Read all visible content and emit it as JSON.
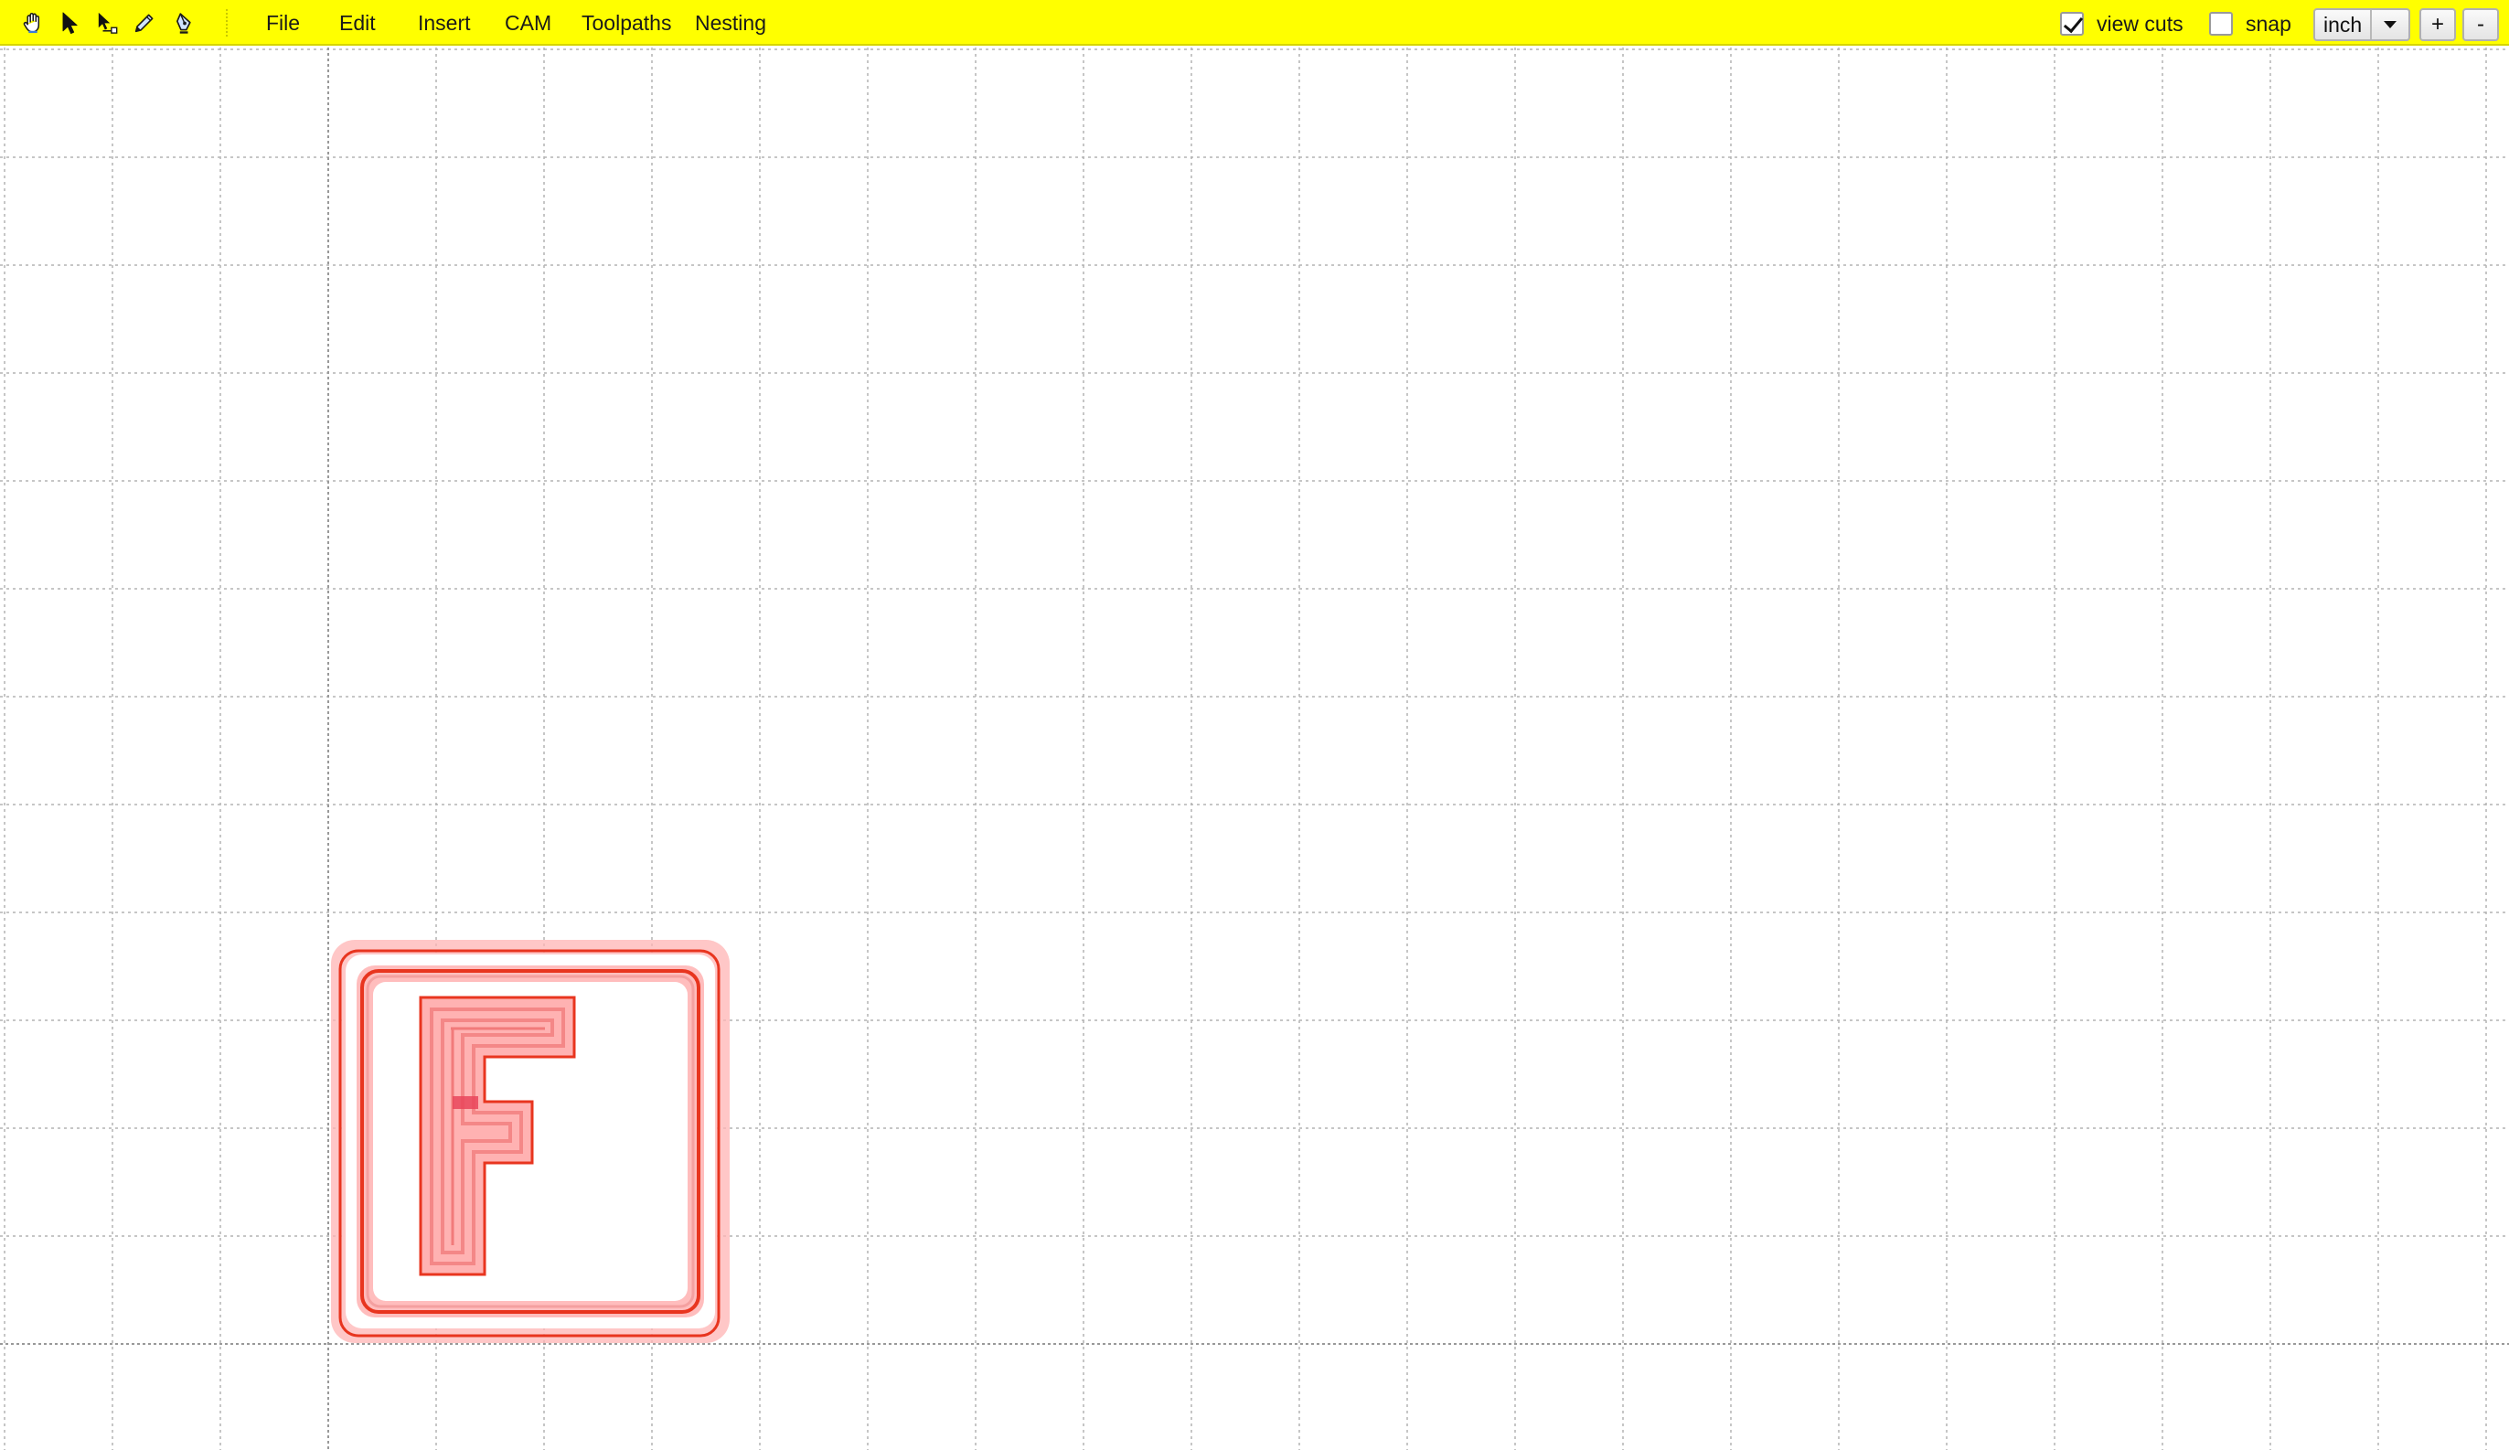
{
  "toolbar": {
    "tools": [
      {
        "name": "pan-hand-icon"
      },
      {
        "name": "select-arrow-icon"
      },
      {
        "name": "node-edit-icon"
      },
      {
        "name": "pencil-icon"
      },
      {
        "name": "pen-tool-icon"
      }
    ],
    "menu": [
      {
        "id": "file",
        "label": "File"
      },
      {
        "id": "edit",
        "label": "Edit"
      },
      {
        "id": "insert",
        "label": "Insert"
      },
      {
        "id": "cam",
        "label": "CAM"
      },
      {
        "id": "toolpaths",
        "label": "Toolpaths"
      },
      {
        "id": "nesting",
        "label": "Nesting"
      }
    ],
    "view_cuts": {
      "label": "view cuts",
      "checked": true
    },
    "snap": {
      "label": "snap",
      "checked": false
    },
    "unit": {
      "value": "inch"
    },
    "zoom_in_label": "+",
    "zoom_out_label": "-",
    "background_color": "#ffff00"
  },
  "canvas": {
    "background_color": "#ffffff",
    "grid_color": "#b3b3b3",
    "axis_color": "#999999",
    "toolpath_color": "#e8351f",
    "toolpath_glow_color": "#ff8f8f",
    "design": {
      "glyph": "F",
      "frame": "rounded-square"
    }
  }
}
